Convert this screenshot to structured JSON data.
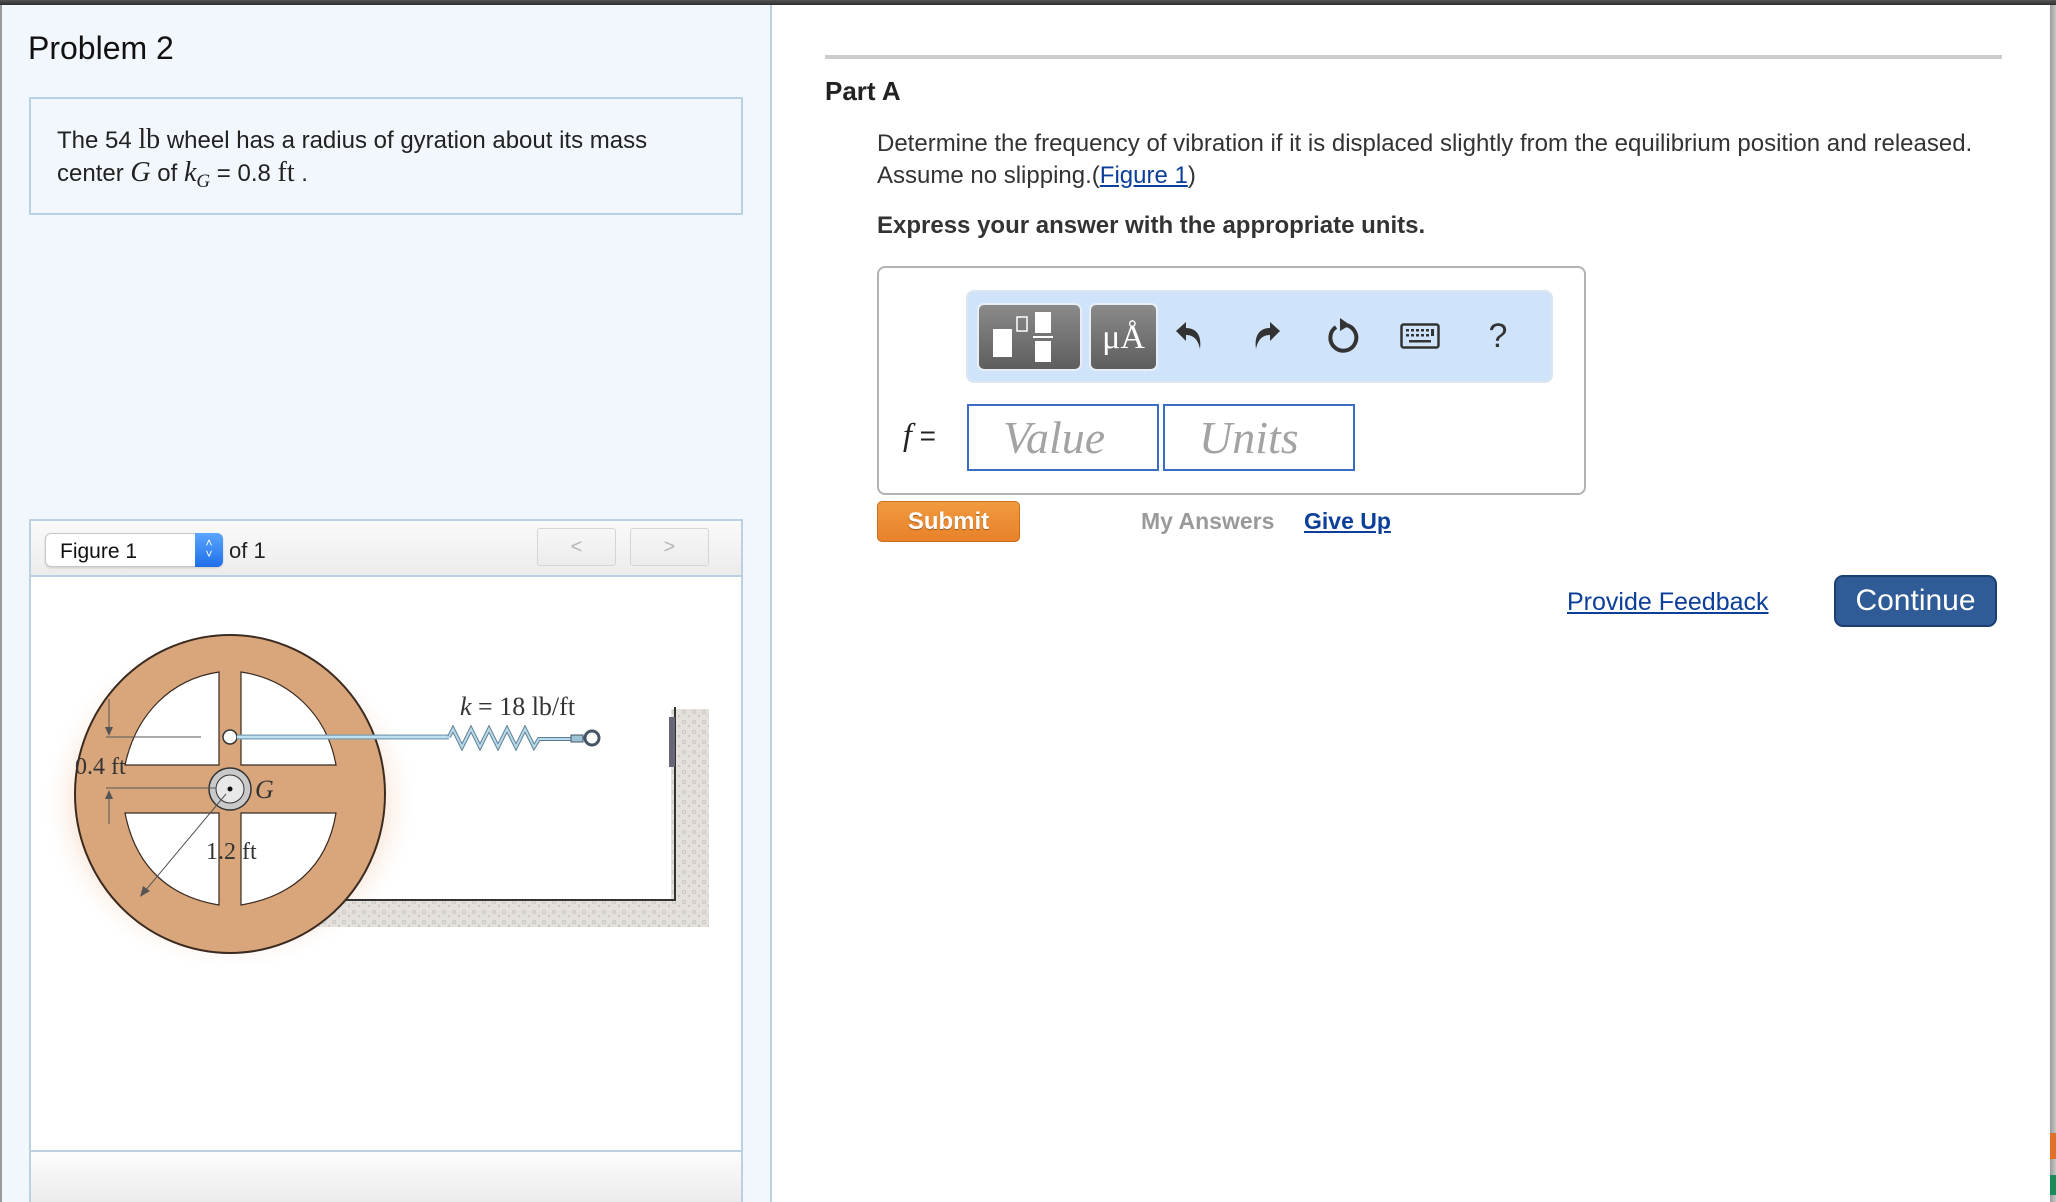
{
  "problem": {
    "title": "Problem 2",
    "statement": {
      "part1": "The 54 ",
      "unit_lb": "lb",
      "part2": " wheel has a radius of gyration about its mass center ",
      "symbol_G": "G",
      "part3": " of ",
      "symbol_k": "k",
      "subscript_G": "G",
      "part4": " = 0.8 ",
      "unit_ft": "ft",
      "part5": " ."
    }
  },
  "figure_panel": {
    "selected_figure": "Figure 1",
    "of_label": "of 1",
    "prev_label": "<",
    "next_label": ">",
    "figure": {
      "spring_label": "k = 18 lb/ft",
      "spring_k_symbol": "k",
      "spring_rest": " = 18 lb/ft",
      "dim_offset": "0.4 ft",
      "dim_radius": "1.2 ft",
      "center_label": "G",
      "colors": {
        "wheel": "#d9a67c",
        "wheel_edge": "#3a2a20",
        "spring": "#a9cde0",
        "ground": "#d8d4ce"
      }
    }
  },
  "part": {
    "title": "Part A",
    "question_text": "Determine the frequency of vibration if it is displaced slightly from the equilibrium position and released. Assume no slipping.(",
    "figure_link": "Figure 1",
    "question_close": ")",
    "instruction": "Express your answer with the appropriate units."
  },
  "answer": {
    "toolbar": {
      "template_icon": "templates-icon",
      "units_label": "μÅ",
      "undo_icon": "undo-icon",
      "redo_icon": "redo-icon",
      "reset_icon": "reset-icon",
      "keyboard_icon": "keyboard-icon",
      "help_label": "?"
    },
    "variable": "f",
    "equals": " =",
    "value_placeholder": "Value",
    "units_placeholder": "Units",
    "value": "",
    "units": ""
  },
  "actions": {
    "submit_label": "Submit",
    "my_answers_label": "My Answers",
    "give_up_label": "Give Up",
    "feedback_label": "Provide Feedback",
    "continue_label": "Continue"
  },
  "colors": {
    "submit": "#ec8a31",
    "continue": "#2f5b96",
    "link": "#0b3f99",
    "input_border": "#3b6dc4",
    "toolbar_bg": "#cfe4fb",
    "left_pane_bg": "#f2f7fd"
  }
}
